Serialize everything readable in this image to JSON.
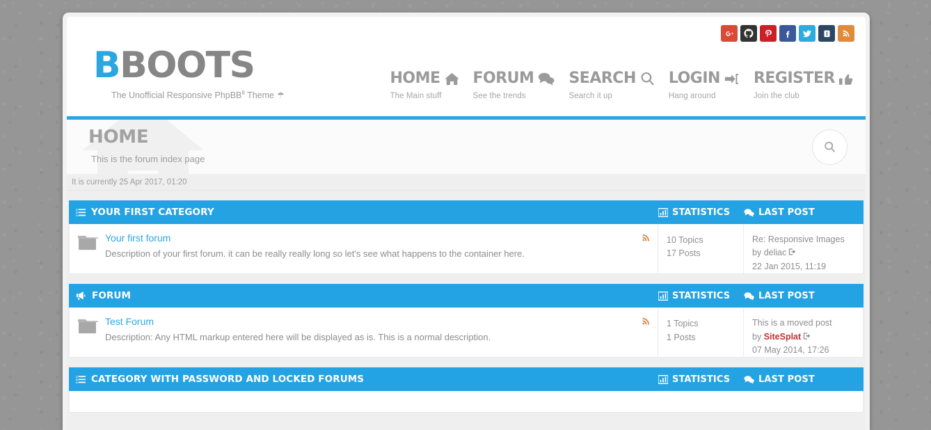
{
  "brand": {
    "logo_first": "B",
    "logo_rest": "BOOTS",
    "tagline_pre": "The Unofficial Responsive PhpBB",
    "tagline_sup": "8",
    "tagline_post": " Theme",
    "umbrella_icon": "umbrella-icon"
  },
  "social": [
    {
      "name": "google-plus-icon",
      "label": "Google Plus",
      "color": "#d94a38"
    },
    {
      "name": "github-icon",
      "label": "GitHub",
      "color": "#333333"
    },
    {
      "name": "pinterest-icon",
      "label": "Pinterest",
      "color": "#cb2027"
    },
    {
      "name": "facebook-icon",
      "label": "Facebook",
      "color": "#3b5998"
    },
    {
      "name": "twitter-icon",
      "label": "Twitter",
      "color": "#2eaae0"
    },
    {
      "name": "instapaper-icon",
      "label": "Instapaper",
      "color": "#2c4762"
    },
    {
      "name": "rss-icon",
      "label": "RSS",
      "color": "#e08b3c"
    }
  ],
  "nav": [
    {
      "label": "HOME",
      "sub": "The Main stuff",
      "icon": "home-icon"
    },
    {
      "label": "FORUM",
      "sub": "See the trends",
      "icon": "comments-icon"
    },
    {
      "label": "SEARCH",
      "sub": "Search it up",
      "icon": "search-icon"
    },
    {
      "label": "LOGIN",
      "sub": "Hang around",
      "icon": "sign-in-icon"
    },
    {
      "label": "REGISTER",
      "sub": "Join the club",
      "icon": "thumbs-up-icon"
    }
  ],
  "page_head": {
    "title": "HOME",
    "subtitle": "This is the forum index page",
    "search_button_icon": "search-icon",
    "watermark_icon": "home-icon"
  },
  "timebar": {
    "text": "It is currently 25 Apr 2017, 01:20"
  },
  "column_headers": {
    "statistics": "STATISTICS",
    "statistics_icon": "bar-chart-icon",
    "last_post": "LAST POST",
    "last_post_icon": "comments-icon"
  },
  "categories": [
    {
      "title": "YOUR FIRST CATEGORY",
      "icon": "tasks-icon",
      "forums": [
        {
          "name": "Your first forum",
          "description": "Description of your first forum. it can be really really long so let's see what happens to the container here.",
          "folder_icon": "folder-icon",
          "rss_icon": "rss-icon",
          "topics": "10 Topics",
          "posts": "17 Posts",
          "last_post_subject": "Re: Responsive Images",
          "last_post_by_prefix": "by ",
          "last_post_author": "deliac",
          "last_post_author_admin": false,
          "last_post_goto_icon": "goto-post-icon",
          "last_post_date": "22 Jan 2015, 11:19"
        }
      ]
    },
    {
      "title": "FORUM",
      "icon": "bullhorn-icon",
      "forums": [
        {
          "name": "Test Forum",
          "description": "Description: Any HTML markup entered here will be displayed as is. This is a normal description.",
          "folder_icon": "folder-icon",
          "rss_icon": "rss-icon",
          "topics": "1 Topics",
          "posts": "1 Posts",
          "last_post_subject": "This is a moved post",
          "last_post_by_prefix": "by ",
          "last_post_author": "SiteSplat",
          "last_post_author_admin": true,
          "last_post_goto_icon": "goto-post-icon",
          "last_post_date": "07 May 2014, 17:26"
        }
      ]
    },
    {
      "title": "CATEGORY WITH PASSWORD AND LOCKED FORUMS",
      "icon": "tasks-icon",
      "forums": []
    }
  ],
  "colors": {
    "accent_blue": "#2ba6e0",
    "category_bar": "#23a3e3",
    "link_blue": "#2ba6e0",
    "admin_red": "#bb3333",
    "page_bg": "#969696",
    "text_grey": "#8d8d8d"
  }
}
